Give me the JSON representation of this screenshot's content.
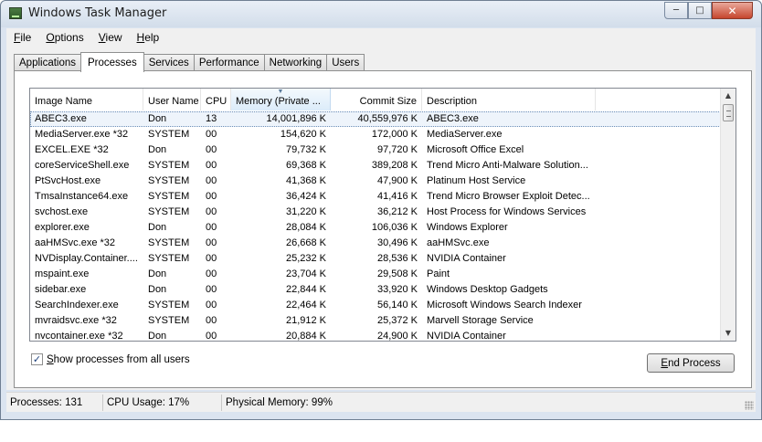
{
  "window": {
    "title": "Windows Task Manager"
  },
  "menu": [
    {
      "label": "File",
      "mnemonic": "F",
      "rest": "ile"
    },
    {
      "label": "Options",
      "mnemonic": "O",
      "rest": "ptions"
    },
    {
      "label": "View",
      "mnemonic": "V",
      "rest": "iew"
    },
    {
      "label": "Help",
      "mnemonic": "H",
      "rest": "elp"
    }
  ],
  "tabs": [
    "Applications",
    "Processes",
    "Services",
    "Performance",
    "Networking",
    "Users"
  ],
  "active_tab": "Processes",
  "columns": {
    "name": "Image Name",
    "user": "User Name",
    "cpu": "CPU",
    "mem": "Memory (Private ...",
    "commit": "Commit Size",
    "desc": "Description"
  },
  "processes": [
    {
      "name": "ABEC3.exe",
      "user": "Don",
      "cpu": "13",
      "mem": "14,001,896 K",
      "commit": "40,559,976 K",
      "desc": "ABEC3.exe",
      "selected": true
    },
    {
      "name": "MediaServer.exe *32",
      "user": "SYSTEM",
      "cpu": "00",
      "mem": "154,620 K",
      "commit": "172,000 K",
      "desc": "MediaServer.exe"
    },
    {
      "name": "EXCEL.EXE *32",
      "user": "Don",
      "cpu": "00",
      "mem": "79,732 K",
      "commit": "97,720 K",
      "desc": "Microsoft Office Excel"
    },
    {
      "name": "coreServiceShell.exe",
      "user": "SYSTEM",
      "cpu": "00",
      "mem": "69,368 K",
      "commit": "389,208 K",
      "desc": "Trend Micro Anti-Malware Solution..."
    },
    {
      "name": "PtSvcHost.exe",
      "user": "SYSTEM",
      "cpu": "00",
      "mem": "41,368 K",
      "commit": "47,900 K",
      "desc": "Platinum Host Service"
    },
    {
      "name": "TmsaInstance64.exe",
      "user": "SYSTEM",
      "cpu": "00",
      "mem": "36,424 K",
      "commit": "41,416 K",
      "desc": "Trend Micro Browser Exploit Detec..."
    },
    {
      "name": "svchost.exe",
      "user": "SYSTEM",
      "cpu": "00",
      "mem": "31,220 K",
      "commit": "36,212 K",
      "desc": "Host Process for Windows Services"
    },
    {
      "name": "explorer.exe",
      "user": "Don",
      "cpu": "00",
      "mem": "28,084 K",
      "commit": "106,036 K",
      "desc": "Windows Explorer"
    },
    {
      "name": "aaHMSvc.exe *32",
      "user": "SYSTEM",
      "cpu": "00",
      "mem": "26,668 K",
      "commit": "30,496 K",
      "desc": "aaHMSvc.exe"
    },
    {
      "name": "NVDisplay.Container....",
      "user": "SYSTEM",
      "cpu": "00",
      "mem": "25,232 K",
      "commit": "28,536 K",
      "desc": "NVIDIA Container"
    },
    {
      "name": "mspaint.exe",
      "user": "Don",
      "cpu": "00",
      "mem": "23,704 K",
      "commit": "29,508 K",
      "desc": "Paint"
    },
    {
      "name": "sidebar.exe",
      "user": "Don",
      "cpu": "00",
      "mem": "22,844 K",
      "commit": "33,920 K",
      "desc": "Windows Desktop Gadgets"
    },
    {
      "name": "SearchIndexer.exe",
      "user": "SYSTEM",
      "cpu": "00",
      "mem": "22,464 K",
      "commit": "56,140 K",
      "desc": "Microsoft Windows Search Indexer"
    },
    {
      "name": "mvraidsvc.exe *32",
      "user": "SYSTEM",
      "cpu": "00",
      "mem": "21,912 K",
      "commit": "25,372 K",
      "desc": "Marvell Storage Service"
    },
    {
      "name": "nvcontainer.exe *32",
      "user": "Don",
      "cpu": "00",
      "mem": "20,884 K",
      "commit": "24,900 K",
      "desc": "NVIDIA Container"
    }
  ],
  "show_all": {
    "label": "Show processes from all users",
    "mnemonic": "S",
    "rest": "how processes from all users",
    "checked": true
  },
  "end_process": {
    "label": "End Process",
    "mnemonic": "E",
    "rest": "nd Process"
  },
  "status": {
    "processes": "Processes: 131",
    "cpu": "CPU Usage: 17%",
    "memory": "Physical Memory: 99%"
  },
  "icons": {
    "app": "task-manager-icon",
    "minimize": "minimize-icon",
    "maximize": "maximize-icon",
    "close": "close-icon"
  }
}
